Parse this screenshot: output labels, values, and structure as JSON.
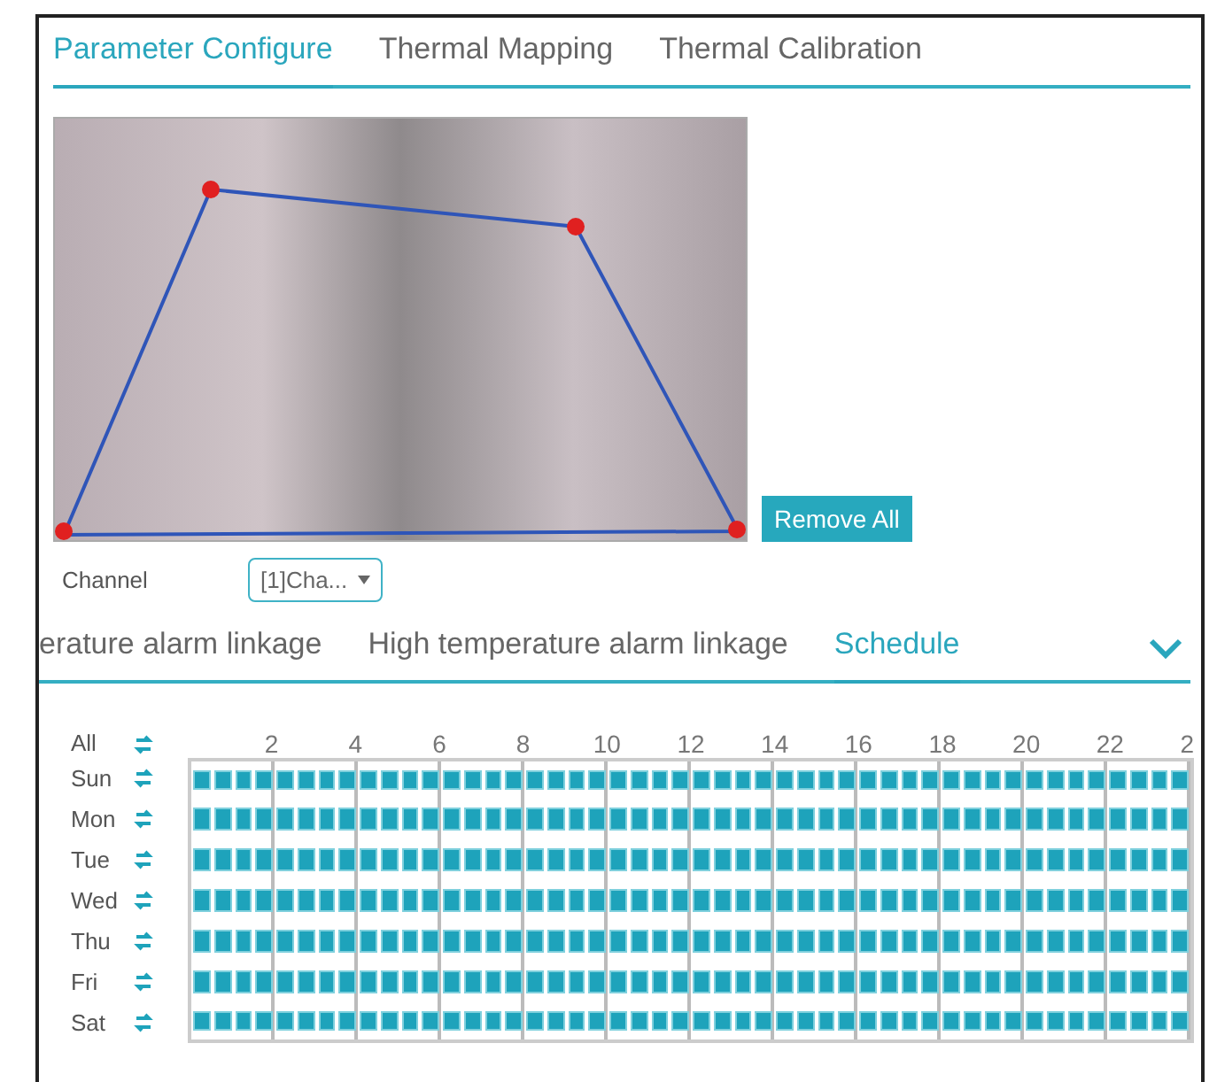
{
  "tabs": [
    {
      "label": "Parameter Configure",
      "selected": true
    },
    {
      "label": "Thermal Mapping",
      "selected": false
    },
    {
      "label": "Thermal Calibration",
      "selected": false
    }
  ],
  "preview": {
    "button": "Remove All"
  },
  "channel": {
    "label": "Channel",
    "value": "[1]Cha..."
  },
  "sub_tabs": [
    {
      "label": "erature alarm linkage",
      "selected": false
    },
    {
      "label": "High temperature alarm linkage",
      "selected": false
    },
    {
      "label": "Schedule",
      "selected": true
    }
  ],
  "schedule": {
    "all_label": "All",
    "hours": [
      "2",
      "4",
      "6",
      "8",
      "10",
      "12",
      "14",
      "16",
      "18",
      "20",
      "22",
      "2"
    ],
    "days": [
      {
        "label": "Sun",
        "armed": true
      },
      {
        "label": "Mon",
        "armed": true
      },
      {
        "label": "Tue",
        "armed": true
      },
      {
        "label": "Wed",
        "armed": true
      },
      {
        "label": "Thu",
        "armed": true
      },
      {
        "label": "Fri",
        "armed": true
      },
      {
        "label": "Sat",
        "armed": true
      }
    ]
  }
}
